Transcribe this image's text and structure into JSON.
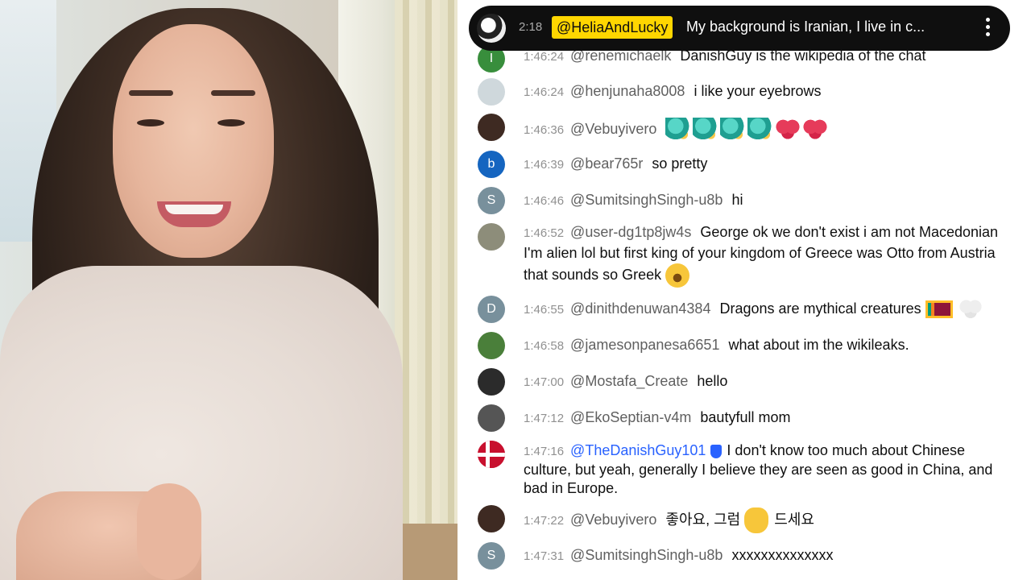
{
  "pinned": {
    "time": "2:18",
    "author": "@HeliaAndLucky",
    "message": "My background is Iranian, I live in c..."
  },
  "colors": {
    "pinned_bg": "#0f0f0f",
    "pinned_author_bg": "#ffd600",
    "member_author": "#2962ff",
    "timestamp": "#909090",
    "author": "#606060"
  },
  "messages": [
    {
      "time": "1:46:24",
      "author": "@renemichaelk",
      "text": "DanishGuy is the wikipedia of the chat",
      "avatar_letter": "I",
      "avatar_color": "#388e3c"
    },
    {
      "time": "1:46:24",
      "author": "@henjunaha8008",
      "text": "i like your eyebrows",
      "avatar_color": "#cfd8dc"
    },
    {
      "time": "1:46:36",
      "author": "@Vebuyivero",
      "text": "",
      "emojis": [
        "dino-icon",
        "dino-icon",
        "dino-icon",
        "dino-icon",
        "heart-icon",
        "heart-icon"
      ],
      "avatar_color": "#3e2a22"
    },
    {
      "time": "1:46:39",
      "author": "@bear765r",
      "text": "so pretty",
      "avatar_letter": "b",
      "avatar_color": "#1565c0"
    },
    {
      "time": "1:46:46",
      "author": "@SumitsinghSingh-u8b",
      "text": "hi",
      "avatar_letter": "S",
      "avatar_color": "#78909c"
    },
    {
      "time": "1:46:52",
      "author": "@user-dg1tp8jw4s",
      "text": "George ok we don't exist i am not Macedonian I'm alien lol but first king of your kingdom of Greece was Otto from Austria that sounds so Greek",
      "avatar_color": "#8d8d7a"
    },
    {
      "time": "1:46:55",
      "author": "@dinithdenuwan4384",
      "text": "Dragons are mythical creatures",
      "avatar_letter": "D",
      "avatar_color": "#78909c"
    },
    {
      "time": "1:46:58",
      "author": "@jamesonpanesa6651",
      "text": "what about im the wikileaks.",
      "avatar_color": "#4a7f3a"
    },
    {
      "time": "1:47:00",
      "author": "@Mostafa_Create",
      "text": "hello",
      "avatar_color": "#2b2b2b"
    },
    {
      "time": "1:47:12",
      "author": "@EkoSeptian-v4m",
      "text": "bautyfull mom",
      "avatar_color": "#555555"
    },
    {
      "time": "1:47:16",
      "author": "@TheDanishGuy101",
      "text": "I don't know too much about Chinese culture, but yeah, generally I believe they are seen as good in China, and bad in Europe.",
      "avatar_color": "#c8102e"
    },
    {
      "time": "1:47:22",
      "author": "@Vebuyivero",
      "text_before": "좋아요, 그럼",
      "text_after": "드세요",
      "avatar_color": "#3e2a22"
    },
    {
      "time": "1:47:31",
      "author": "@SumitsinghSingh-u8b",
      "text": "xxxxxxxxxxxxxx",
      "avatar_letter": "S",
      "avatar_color": "#78909c"
    }
  ]
}
